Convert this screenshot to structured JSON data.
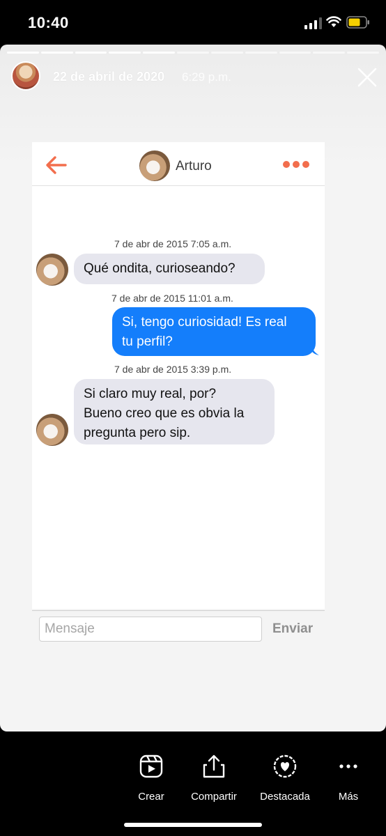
{
  "status_bar": {
    "time": "10:40"
  },
  "story": {
    "date": "22 de abril de 2020",
    "time": "6:29 p.m.",
    "progress_segments": 11,
    "active_segment": 5
  },
  "chat": {
    "contact_name": "Arturo",
    "accent_color": "#f26e4d",
    "messages": [
      {
        "timestamp": "7 de abr de 2015 7:05 a.m.",
        "direction": "in",
        "lines": [
          "Qué ondita, curioseando?"
        ]
      },
      {
        "timestamp": "7 de abr de 2015 11:01 a.m.",
        "direction": "out",
        "lines": [
          "Si, tengo curiosidad! Es real",
          "tu perfil?"
        ]
      },
      {
        "timestamp": "7 de abr de 2015 3:39 p.m.",
        "direction": "in",
        "lines": [
          "Si claro muy real, por?",
          "Bueno creo que es obvia la",
          "pregunta pero sip."
        ]
      }
    ],
    "input_placeholder": "Mensaje",
    "send_label": "Enviar"
  },
  "bottom_actions": [
    {
      "label": "Crear",
      "icon": "reels-icon"
    },
    {
      "label": "Compartir",
      "icon": "share-icon"
    },
    {
      "label": "Destacada",
      "icon": "highlight-heart-icon"
    },
    {
      "label": "Más",
      "icon": "more-icon"
    }
  ]
}
